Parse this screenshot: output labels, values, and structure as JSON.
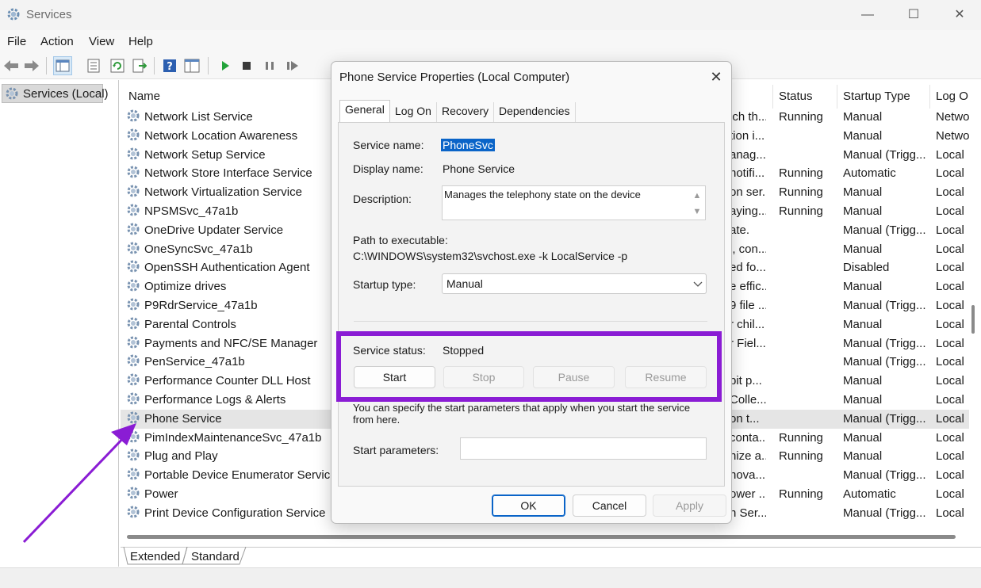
{
  "window": {
    "title": "Services",
    "controls": {
      "minimize": "—",
      "maximize": "☐",
      "close": "✕"
    }
  },
  "menu": [
    "File",
    "Action",
    "View",
    "Help"
  ],
  "toolbar": {
    "icons": [
      "back-arrow-icon",
      "forward-arrow-icon",
      "console-tree-icon",
      "properties-icon",
      "refresh-icon",
      "export-list-icon",
      "help-icon",
      "show-hide-icon",
      "start-service-icon",
      "stop-service-icon",
      "pause-service-icon",
      "restart-service-icon"
    ]
  },
  "tree": {
    "root": "Services (Local)"
  },
  "list": {
    "columns": {
      "name": "Name",
      "status": "Status",
      "startup": "Startup Type",
      "logon": "Log O"
    },
    "rows": [
      {
        "name": "Network List Service",
        "desc": "ich th...",
        "status": "Running",
        "startup": "Manual",
        "logon": "Netwo"
      },
      {
        "name": "Network Location Awareness",
        "desc": "tion i...",
        "status": "",
        "startup": "Manual",
        "logon": "Netwo"
      },
      {
        "name": "Network Setup Service",
        "desc": "anag...",
        "status": "",
        "startup": "Manual (Trigg...",
        "logon": "Local"
      },
      {
        "name": "Network Store Interface Service",
        "desc": "notifi...",
        "status": "Running",
        "startup": "Automatic",
        "logon": "Local"
      },
      {
        "name": "Network Virtualization Service",
        "desc": "on ser...",
        "status": "Running",
        "startup": "Manual",
        "logon": "Local"
      },
      {
        "name": "NPSMSvc_47a1b",
        "desc": "aying...",
        "status": "Running",
        "startup": "Manual",
        "logon": "Local"
      },
      {
        "name": "OneDrive Updater Service",
        "desc": "ate.",
        "status": "",
        "startup": "Manual (Trigg...",
        "logon": "Local"
      },
      {
        "name": "OneSyncSvc_47a1b",
        "desc": "l, con...",
        "status": "",
        "startup": "Manual",
        "logon": "Local"
      },
      {
        "name": "OpenSSH Authentication Agent",
        "desc": "ed fo...",
        "status": "",
        "startup": "Disabled",
        "logon": "Local"
      },
      {
        "name": "Optimize drives",
        "desc": "e effic...",
        "status": "",
        "startup": "Manual",
        "logon": "Local"
      },
      {
        "name": "P9RdrService_47a1b",
        "desc": "9 file ...",
        "status": "",
        "startup": "Manual (Trigg...",
        "logon": "Local"
      },
      {
        "name": "Parental Controls",
        "desc": "r chil...",
        "status": "",
        "startup": "Manual",
        "logon": "Local"
      },
      {
        "name": "Payments and NFC/SE Manager",
        "desc": "r Fiel...",
        "status": "",
        "startup": "Manual (Trigg...",
        "logon": "Local"
      },
      {
        "name": "PenService_47a1b",
        "desc": "",
        "status": "",
        "startup": "Manual (Trigg...",
        "logon": "Local"
      },
      {
        "name": "Performance Counter DLL Host",
        "desc": "bit p...",
        "status": "",
        "startup": "Manual",
        "logon": "Local"
      },
      {
        "name": "Performance Logs & Alerts",
        "desc": "Colle...",
        "status": "",
        "startup": "Manual",
        "logon": "Local"
      },
      {
        "name": "Phone Service",
        "desc": "on t...",
        "status": "",
        "startup": "Manual (Trigg...",
        "logon": "Local"
      },
      {
        "name": "PimIndexMaintenanceSvc_47a1b",
        "desc": "conta...",
        "status": "Running",
        "startup": "Manual",
        "logon": "Local"
      },
      {
        "name": "Plug and Play",
        "desc": "nize a...",
        "status": "Running",
        "startup": "Manual",
        "logon": "Local"
      },
      {
        "name": "Portable Device Enumerator Service",
        "desc": "nova...",
        "status": "",
        "startup": "Manual (Trigg...",
        "logon": "Local"
      },
      {
        "name": "Power",
        "desc": "ower ...",
        "status": "Running",
        "startup": "Automatic",
        "logon": "Local"
      },
      {
        "name": "Print Device Configuration Service",
        "desc": "n Ser...",
        "status": "",
        "startup": "Manual (Trigg...",
        "logon": "Local"
      }
    ],
    "selected_index": 16
  },
  "bottom_tabs": [
    "Extended",
    "Standard"
  ],
  "dialog": {
    "title": "Phone Service Properties (Local Computer)",
    "tabs": [
      "General",
      "Log On",
      "Recovery",
      "Dependencies"
    ],
    "active_tab": "General",
    "service_name_label": "Service name:",
    "service_name": "PhoneSvc",
    "display_name_label": "Display name:",
    "display_name": "Phone Service",
    "description_label": "Description:",
    "description": "Manages the telephony state on the device",
    "path_label": "Path to executable:",
    "path": "C:\\WINDOWS\\system32\\svchost.exe -k LocalService -p",
    "startup_type_label": "Startup type:",
    "startup_type": "Manual",
    "service_status_label": "Service status:",
    "service_status": "Stopped",
    "buttons": {
      "start": "Start",
      "stop": "Stop",
      "pause": "Pause",
      "resume": "Resume"
    },
    "params_note": "You can specify the start parameters that apply when you start the service from here.",
    "start_params_label": "Start parameters:",
    "start_params_value": "",
    "footer": {
      "ok": "OK",
      "cancel": "Cancel",
      "apply": "Apply"
    }
  },
  "annotation_color": "#8a1cd4"
}
